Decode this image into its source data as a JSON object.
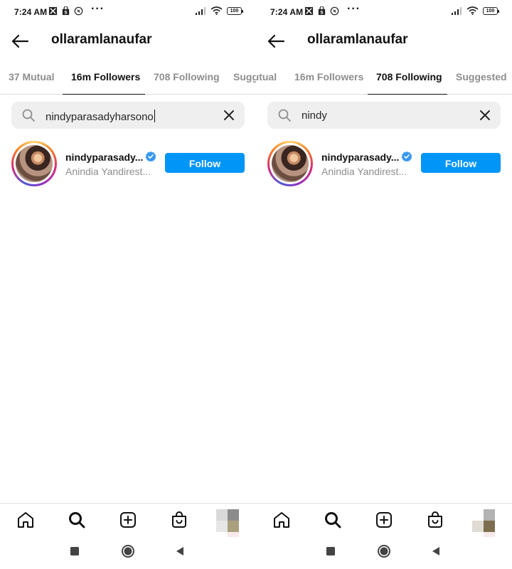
{
  "screens": [
    {
      "status": {
        "time": "7:24 AM",
        "more": "···",
        "battery": "100"
      },
      "header": {
        "title": "ollaramlanaufar"
      },
      "tabs": [
        {
          "label": "37 Mutual",
          "active": false
        },
        {
          "label": "16m Followers",
          "active": true
        },
        {
          "label": "708 Following",
          "active": false
        },
        {
          "label": "Suggested",
          "active": false
        }
      ],
      "search": {
        "value": "nindyparasadyharsono"
      },
      "result": {
        "username": "nindyparasady...",
        "fullname": "Anindia Yandirest...",
        "verified": true,
        "follow_label": "Follow"
      }
    },
    {
      "status": {
        "time": "7:24 AM",
        "more": "···",
        "battery": "100"
      },
      "header": {
        "title": "ollaramlanaufar"
      },
      "tabs": [
        {
          "label": "Mutual",
          "active": false
        },
        {
          "label": "16m Followers",
          "active": false
        },
        {
          "label": "708 Following",
          "active": true
        },
        {
          "label": "Suggested",
          "active": false
        }
      ],
      "search": {
        "value": "nindy"
      },
      "result": {
        "username": "nindyparasady...",
        "fullname": "Anindia Yandirest...",
        "verified": true,
        "follow_label": "Follow"
      }
    }
  ],
  "colors": {
    "accent": "#0095f6",
    "verified": "#3897f0",
    "muted": "#8e8e8e"
  },
  "icons": {
    "status": [
      "notification-icon",
      "bag-notification-icon",
      "whatsapp-icon",
      "signal-icon",
      "wifi-icon",
      "battery-icon"
    ],
    "header": [
      "back-arrow-icon"
    ],
    "search": [
      "search-icon",
      "clear-icon"
    ],
    "bottom_nav": [
      "home-icon",
      "search-icon",
      "new-post-icon",
      "shop-icon",
      "profile-avatar"
    ],
    "system_nav": [
      "recents-square-icon",
      "home-circle-icon",
      "back-triangle-icon"
    ]
  }
}
